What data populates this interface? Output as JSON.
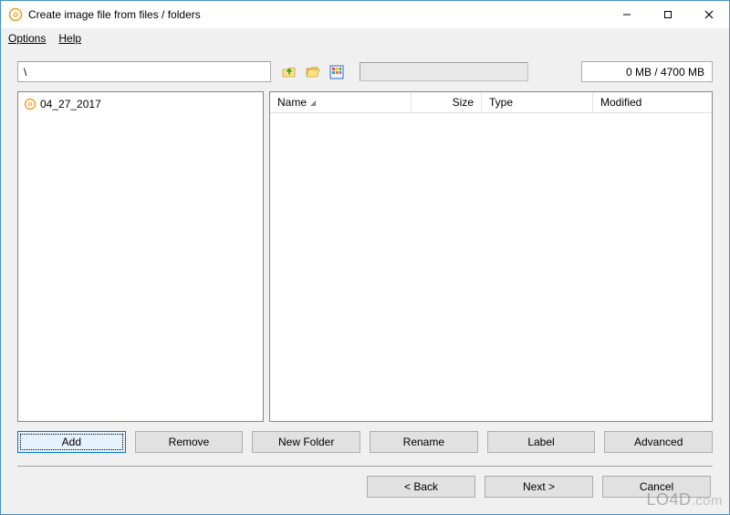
{
  "window": {
    "title": "Create image file from files / folders"
  },
  "menu": {
    "options": "Options",
    "help": "Help"
  },
  "toolbar": {
    "path_value": "\\",
    "up_icon": "folder-up-icon",
    "open_icon": "folder-open-icon",
    "view_icon": "view-grid-icon",
    "size_text": "0 MB / 4700 MB"
  },
  "tree": {
    "items": [
      {
        "label": "04_27_2017"
      }
    ]
  },
  "columns": {
    "name": "Name",
    "size": "Size",
    "type": "Type",
    "modified": "Modified"
  },
  "buttons": {
    "add": "Add",
    "remove": "Remove",
    "newfolder": "New Folder",
    "rename": "Rename",
    "label": "Label",
    "advanced": "Advanced"
  },
  "wizard": {
    "back": "< Back",
    "next": "Next >",
    "cancel": "Cancel"
  },
  "watermark": {
    "brand": "LO4D",
    "tld": ".com"
  }
}
